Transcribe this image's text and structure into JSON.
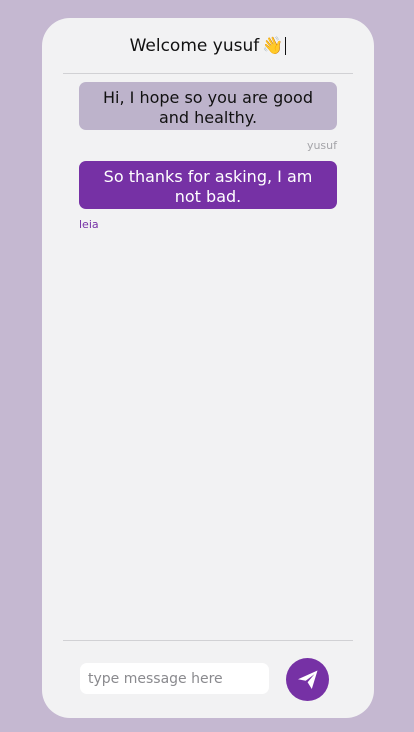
{
  "header": {
    "welcome_text": "Welcome yusuf",
    "wave_emoji": "👋"
  },
  "messages": [
    {
      "text": "Hi, I hope so you are good and healthy.",
      "sender": "yusuf",
      "direction": "received",
      "color": "#bdb3cb"
    },
    {
      "text": "So thanks for asking, I am not bad.",
      "sender": "leia",
      "direction": "sent",
      "color": "#7631a5"
    }
  ],
  "composer": {
    "placeholder": "type message here",
    "value": "",
    "send_icon": "paper-plane-icon"
  },
  "colors": {
    "background": "#c5b8d1",
    "panel": "#f2f2f3",
    "accent": "#7631a5",
    "received_bubble": "#bdb3cb"
  }
}
